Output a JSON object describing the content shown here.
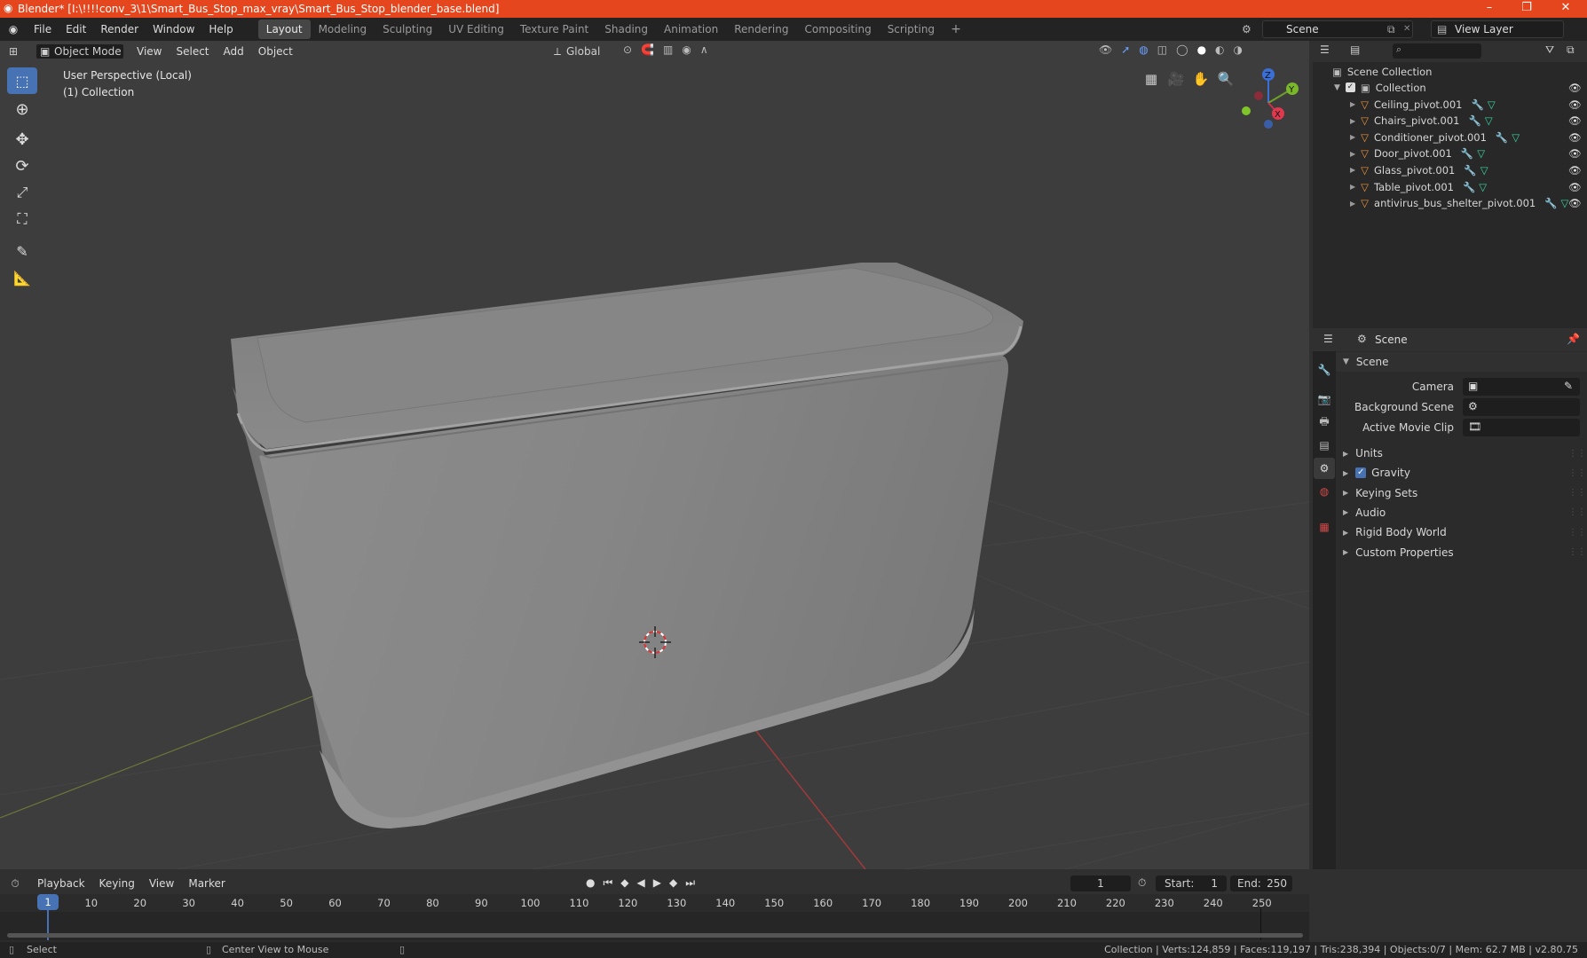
{
  "window": {
    "title": "Blender* [I:\\!!!!conv_3\\1\\Smart_Bus_Stop_max_vray\\Smart_Bus_Stop_blender_base.blend]",
    "minimize": "–",
    "maximize": "❐",
    "close": "✕"
  },
  "menu": {
    "file": "File",
    "edit": "Edit",
    "render": "Render",
    "window": "Window",
    "help": "Help"
  },
  "workspaces": [
    "Layout",
    "Modeling",
    "Sculpting",
    "UV Editing",
    "Texture Paint",
    "Shading",
    "Animation",
    "Rendering",
    "Compositing",
    "Scripting"
  ],
  "workspace_add": "+",
  "scene": {
    "name": "Scene",
    "view_layer": "View Layer"
  },
  "viewport": {
    "mode": "Object Mode",
    "view": "View",
    "select": "Select",
    "add": "Add",
    "object": "Object",
    "transform": "Global",
    "overlay_line1": "User Perspective (Local)",
    "overlay_line2": "(1) Collection",
    "gizmo": {
      "z": "Z",
      "y": "Y",
      "x": "X"
    }
  },
  "outliner": {
    "root": "Scene Collection",
    "collection": "Collection",
    "items": [
      "Ceiling_pivot.001",
      "Chairs_pivot.001",
      "Conditioner_pivot.001",
      "Door_pivot.001",
      "Glass_pivot.001",
      "Table_pivot.001",
      "antivirus_bus_shelter_pivot.001"
    ]
  },
  "properties": {
    "header": "Scene",
    "panel": "Scene",
    "camera_label": "Camera",
    "bg_scene_label": "Background Scene",
    "movie_clip_label": "Active Movie Clip",
    "sections": [
      "Units",
      "Gravity",
      "Keying Sets",
      "Audio",
      "Rigid Body World",
      "Custom Properties"
    ]
  },
  "timeline": {
    "playback": "Playback",
    "keying": "Keying",
    "view": "View",
    "marker": "Marker",
    "current_frame": "1",
    "start_label": "Start:",
    "start": "1",
    "end_label": "End:",
    "end": "250",
    "ticks": [
      "10",
      "20",
      "30",
      "40",
      "50",
      "60",
      "70",
      "80",
      "90",
      "100",
      "110",
      "120",
      "130",
      "140",
      "150",
      "160",
      "170",
      "180",
      "190",
      "200",
      "210",
      "220",
      "230",
      "240",
      "250"
    ],
    "current_marker": "1"
  },
  "status": {
    "select": "Select",
    "center": "Center View to Mouse",
    "stats": "Collection | Verts:124,859 | Faces:119,197 | Tris:238,394 | Objects:0/7 | Mem: 62.7 MB | v2.80.75"
  },
  "colors": {
    "accent": "#4772b3",
    "titlebar": "#e5461e",
    "mesh_icon": "#e8913a",
    "modifier_icon": "#5fa0e8",
    "data_icon": "#38d4a4"
  }
}
